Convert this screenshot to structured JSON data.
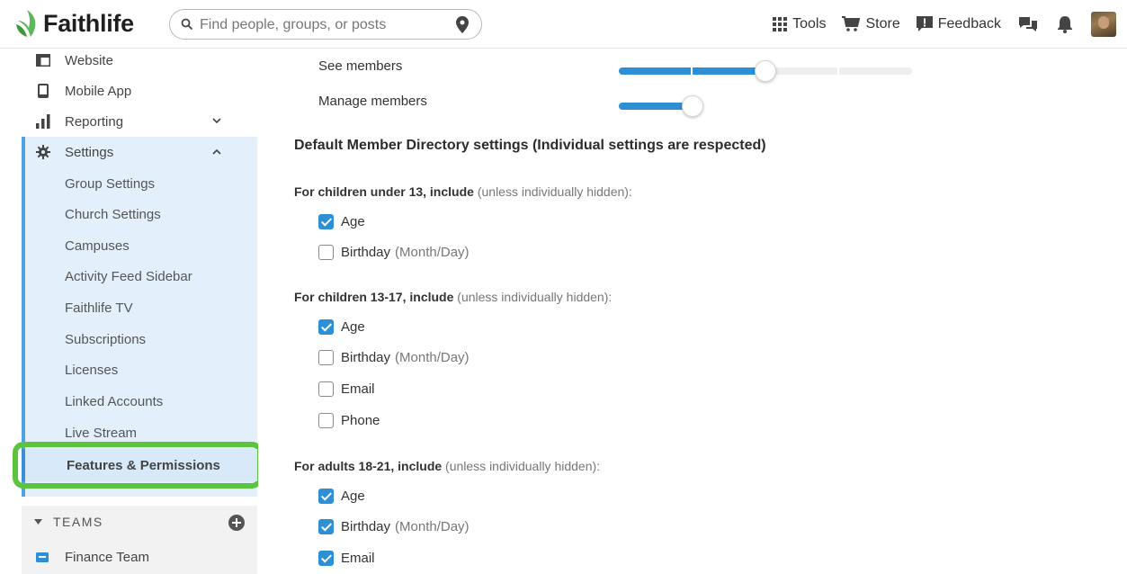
{
  "brand": {
    "name": "Faithlife",
    "leaf_color": "#5cb85c"
  },
  "search": {
    "placeholder": "Find people, groups, or posts"
  },
  "nav": {
    "tools": "Tools",
    "store": "Store",
    "feedback": "Feedback"
  },
  "sidebar": {
    "top_items": [
      {
        "label": "Website",
        "icon": "website-icon"
      },
      {
        "label": "Mobile App",
        "icon": "mobile-icon"
      },
      {
        "label": "Reporting",
        "icon": "reporting-icon"
      },
      {
        "label": "Settings",
        "icon": "gear-icon"
      }
    ],
    "settings_items": [
      "Group Settings",
      "Church Settings",
      "Campuses",
      "Activity Feed Sidebar",
      "Faithlife TV",
      "Subscriptions",
      "Licenses",
      "Linked Accounts",
      "Live Stream"
    ],
    "active_item": "Features & Permissions",
    "teams_header": "TEAMS",
    "team_row": "Finance Team"
  },
  "main": {
    "sliders": [
      {
        "label": "See members",
        "level": 0.5
      },
      {
        "label": "Manage members",
        "level": 0.25
      }
    ],
    "section_title": "Default Member Directory settings (Individual settings are respected)",
    "groups": [
      {
        "head": "For children under 13, include",
        "sub": "(unless individually hidden):",
        "options": [
          {
            "label": "Age",
            "note": "",
            "checked": true
          },
          {
            "label": "Birthday",
            "note": "(Month/Day)",
            "checked": false
          }
        ]
      },
      {
        "head": "For children 13-17, include",
        "sub": "(unless individually hidden):",
        "options": [
          {
            "label": "Age",
            "note": "",
            "checked": true
          },
          {
            "label": "Birthday",
            "note": "(Month/Day)",
            "checked": false
          },
          {
            "label": "Email",
            "note": "",
            "checked": false
          },
          {
            "label": "Phone",
            "note": "",
            "checked": false
          }
        ]
      },
      {
        "head": "For adults 18-21, include",
        "sub": "(unless individually hidden):",
        "options": [
          {
            "label": "Age",
            "note": "",
            "checked": true
          },
          {
            "label": "Birthday",
            "note": "(Month/Day)",
            "checked": true
          },
          {
            "label": "Email",
            "note": "",
            "checked": true
          }
        ]
      }
    ]
  },
  "colors": {
    "accent": "#2d8fd5",
    "highlight_outline": "#5cc33e",
    "settings_bg": "#e3f0fb"
  }
}
